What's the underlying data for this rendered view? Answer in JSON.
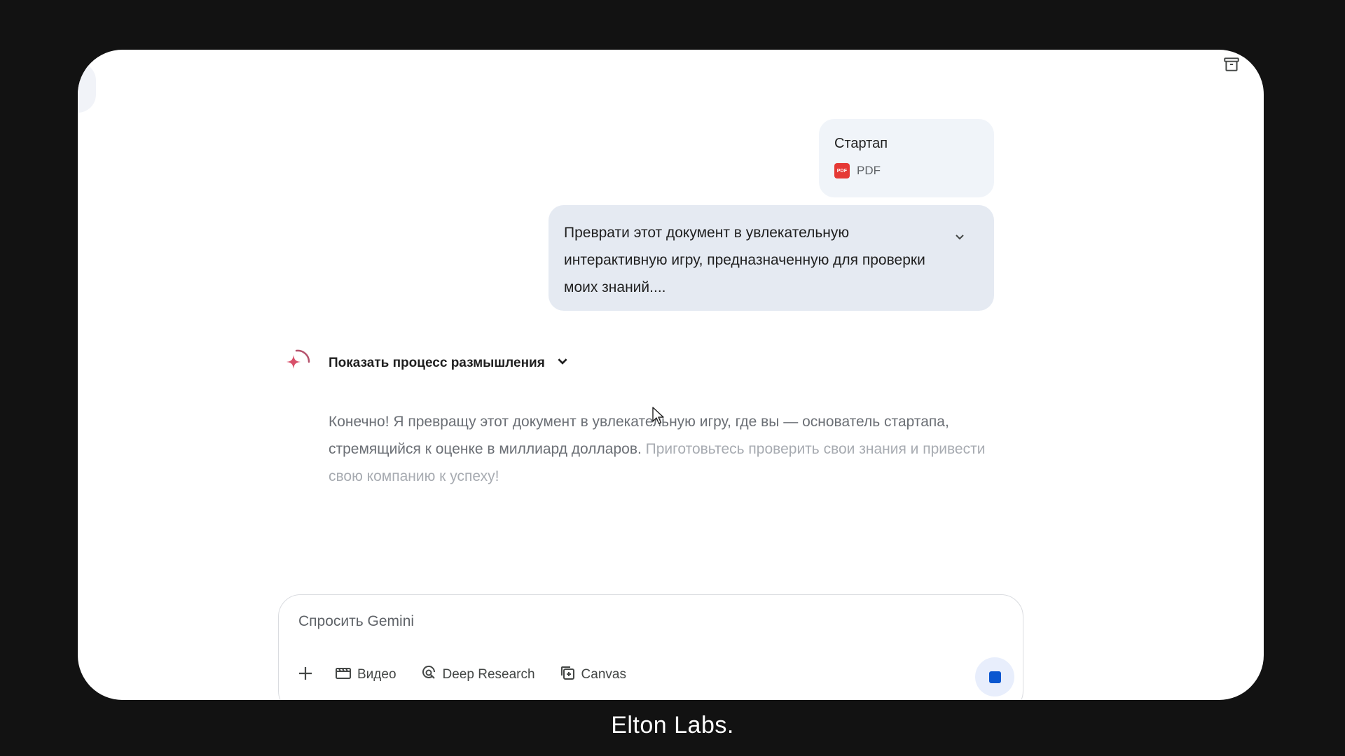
{
  "attachment": {
    "title": "Стартап",
    "type_label": "PDF",
    "icon": "pdf-file-icon"
  },
  "prompt": {
    "text": "Преврати этот документ в увлекательную интерактивную игру, предназначенную для проверки моих знаний...."
  },
  "response": {
    "thinking_label": "Показать процесс размышления",
    "text_main": "Конечно! Я превращу этот документ в увлекательную игру, где вы — основатель стартапа, стремящийся к оценке в миллиард долларов.",
    "text_faded": "Приготовьтесь проверить свои знания и привести свою компанию к успеху!"
  },
  "input": {
    "placeholder": "Спросить Gemini",
    "tools": [
      {
        "label": "Видео",
        "icon": "video-icon"
      },
      {
        "label": "Deep Research",
        "icon": "deep-research-icon"
      },
      {
        "label": "Canvas",
        "icon": "canvas-icon"
      }
    ]
  },
  "branding": {
    "text": "Elton Labs."
  },
  "colors": {
    "accent": "#0b57d0",
    "bubble": "#e5eaf2",
    "background": "#121212",
    "pdf": "#e53935"
  }
}
